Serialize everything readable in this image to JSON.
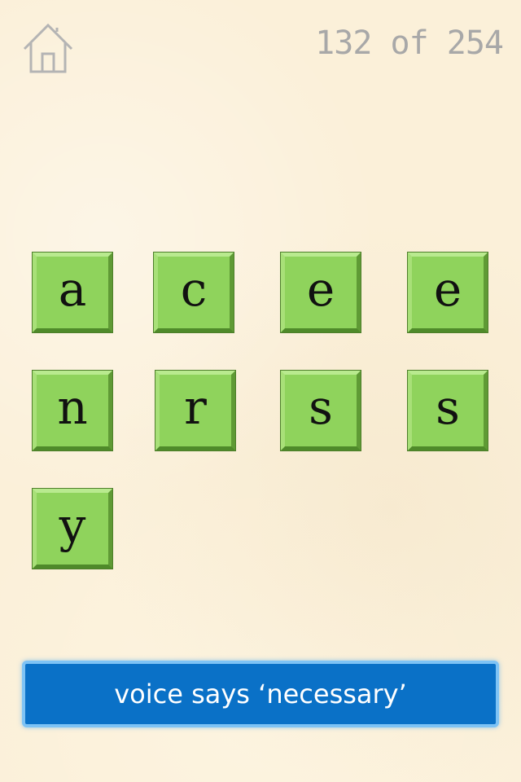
{
  "header": {
    "home_icon": "house-icon",
    "progress": "132 of 254"
  },
  "tiles": [
    {
      "letter": "a"
    },
    {
      "letter": "c"
    },
    {
      "letter": "e"
    },
    {
      "letter": "e"
    },
    {
      "letter": "n"
    },
    {
      "letter": "r"
    },
    {
      "letter": "s"
    },
    {
      "letter": "s"
    },
    {
      "letter": "y"
    }
  ],
  "voice_button": {
    "label": "voice says ‘necessary’"
  },
  "colors": {
    "background": "#fbf0d9",
    "tile": "#8fd35c",
    "voice_button": "#0a71c7",
    "progress_text": "#a8a8a8"
  }
}
